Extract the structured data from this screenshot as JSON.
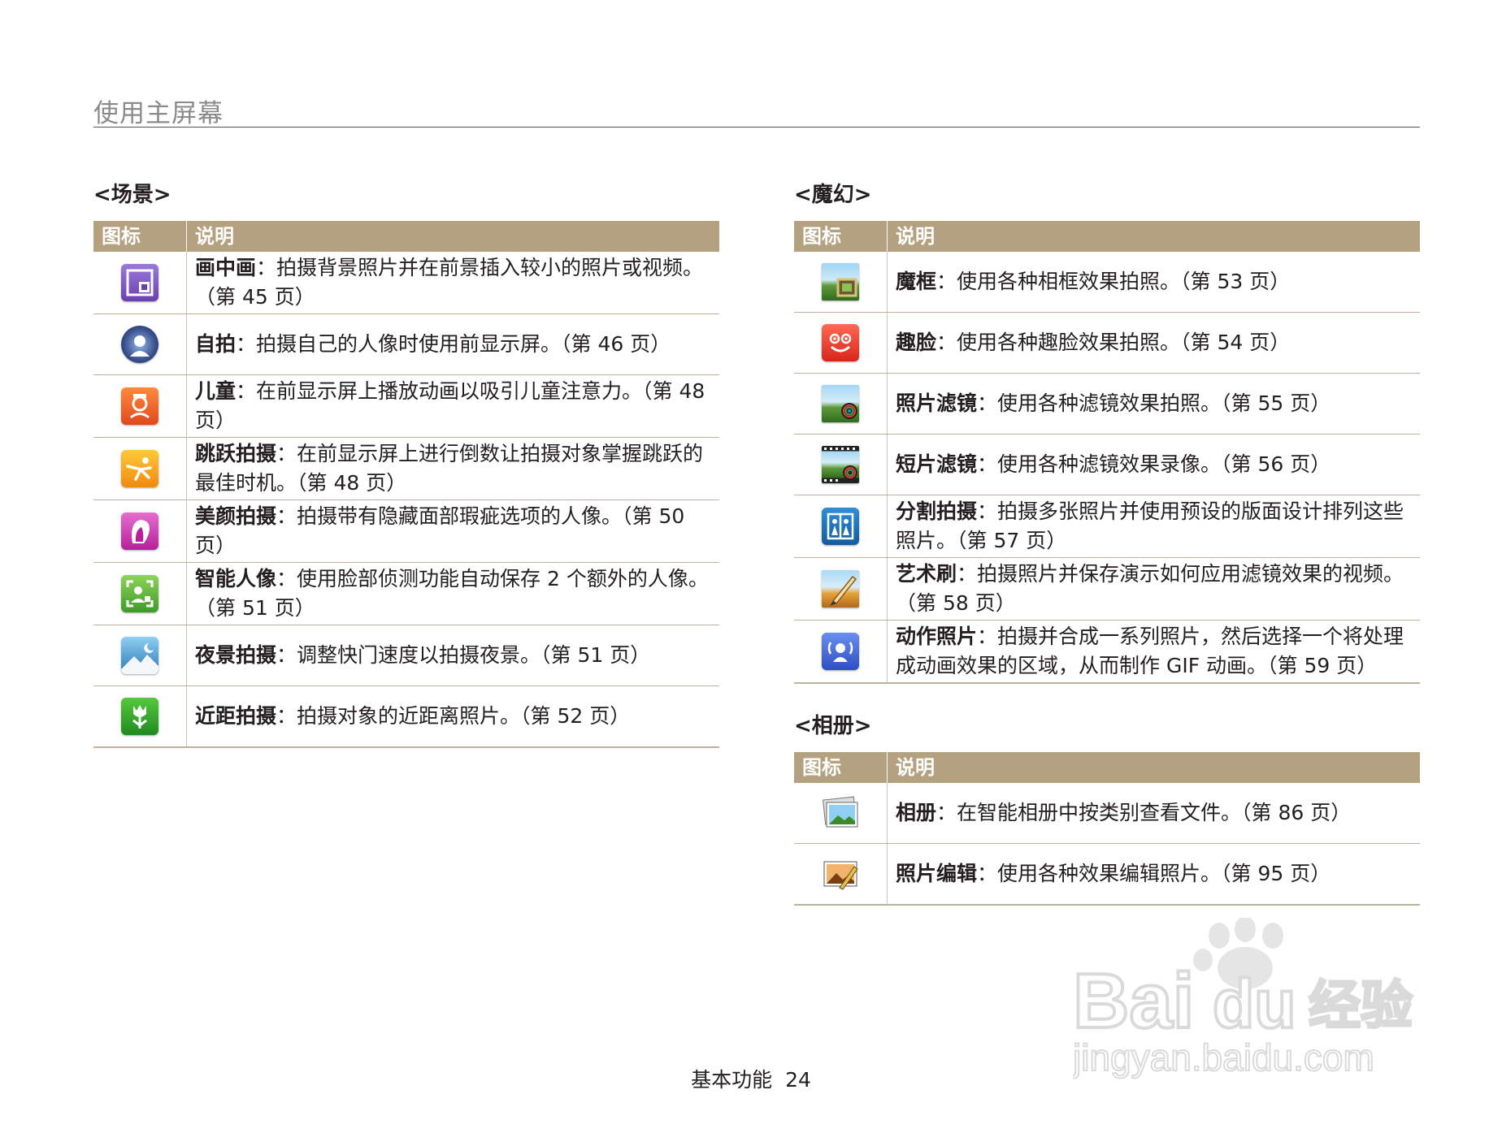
{
  "header": {
    "title": "使用主屏幕"
  },
  "table_header": {
    "icon": "图标",
    "desc": "说明"
  },
  "sections": {
    "scene": {
      "title": "<场景>",
      "rows": [
        {
          "icon": "picture-in-picture-icon",
          "name": "画中画",
          "text": "：拍摄背景照片并在前景插入较小的照片或视频。（第 45 页）"
        },
        {
          "icon": "self-shot-icon",
          "name": "自拍",
          "text": "：拍摄自己的人像时使用前显示屏。（第 46 页）"
        },
        {
          "icon": "children-icon",
          "name": "儿童",
          "text": "：在前显示屏上播放动画以吸引儿童注意力。（第 48 页）"
        },
        {
          "icon": "jump-shot-icon",
          "name": "跳跃拍摄",
          "text": "：在前显示屏上进行倒数让拍摄对象掌握跳跃的最佳时机。（第 48 页）"
        },
        {
          "icon": "beauty-shot-icon",
          "name": "美颜拍摄",
          "text": "：拍摄带有隐藏面部瑕疵选项的人像。（第 50 页）"
        },
        {
          "icon": "smart-portrait-icon",
          "name": "智能人像",
          "text": "：使用脸部侦测功能自动保存 2 个额外的人像。（第 51 页）"
        },
        {
          "icon": "night-shot-icon",
          "name": "夜景拍摄",
          "text": "：调整快门速度以拍摄夜景。（第 51 页）"
        },
        {
          "icon": "close-up-icon",
          "name": "近距拍摄",
          "text": "：拍摄对象的近距离照片。（第 52 页）"
        }
      ]
    },
    "magic": {
      "title": "<魔幻>",
      "rows": [
        {
          "icon": "magic-frame-icon",
          "name": "魔框",
          "text": "：使用各种相框效果拍照。（第 53 页）"
        },
        {
          "icon": "funny-face-icon",
          "name": "趣脸",
          "text": "：使用各种趣脸效果拍照。（第 54 页）"
        },
        {
          "icon": "photo-filter-icon",
          "name": "照片滤镜",
          "text": "：使用各种滤镜效果拍照。（第 55 页）"
        },
        {
          "icon": "movie-filter-icon",
          "name": "短片滤镜",
          "text": "：使用各种滤镜效果录像。（第 56 页）"
        },
        {
          "icon": "split-shot-icon",
          "name": "分割拍摄",
          "text": "：拍摄多张照片并使用预设的版面设计排列这些照片。（第 57 页）"
        },
        {
          "icon": "artistic-brush-icon",
          "name": "艺术刷",
          "text": "：拍摄照片并保存演示如何应用滤镜效果的视频。（第 58 页）"
        },
        {
          "icon": "motion-photo-icon",
          "name": "动作照片",
          "text": "：拍摄并合成一系列照片，然后选择一个将处理成动画效果的区域，从而制作 GIF 动画。（第 59 页）"
        }
      ]
    },
    "album": {
      "title": "<相册>",
      "rows": [
        {
          "icon": "album-icon",
          "name": "相册",
          "text": "：在智能相册中按类别查看文件。（第 86 页）"
        },
        {
          "icon": "photo-editor-icon",
          "name": "照片编辑",
          "text": "：使用各种效果编辑照片。（第 95 页）"
        }
      ]
    }
  },
  "footer": {
    "label": "基本功能",
    "page": "24"
  },
  "watermark": {
    "brand": "Bai",
    "brand2": "du",
    "cn": "经验",
    "url": "jingyan.baidu.com"
  }
}
